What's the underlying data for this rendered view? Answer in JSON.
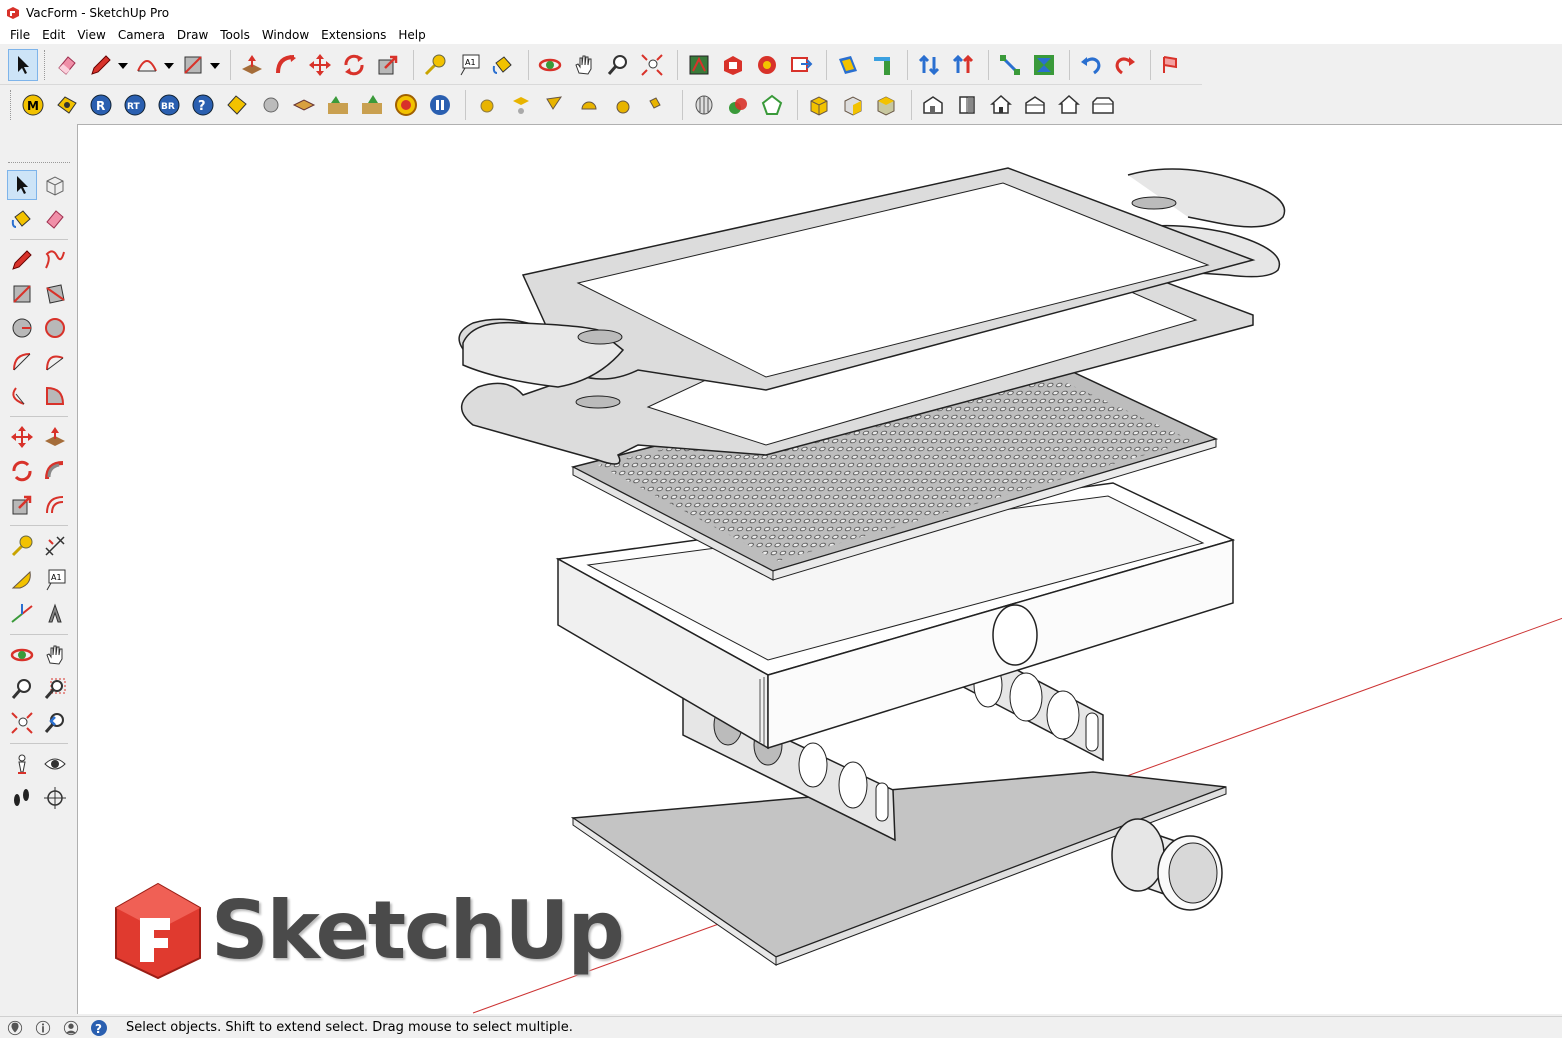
{
  "window": {
    "title": "VacForm - SketchUp Pro"
  },
  "menu": [
    "File",
    "Edit",
    "View",
    "Camera",
    "Draw",
    "Tools",
    "Window",
    "Extensions",
    "Help"
  ],
  "toolbar_row1": [
    "select",
    "eraser",
    "pencil",
    "dropdown",
    "arc",
    "dropdown",
    "rectangle",
    "dropdown",
    "push-pull",
    "follow-me",
    "move",
    "rotate",
    "scale",
    "tape-measure",
    "text",
    "paint-bucket",
    "orbit",
    "pan",
    "zoom",
    "zoom-extents",
    "warehouse",
    "extension-warehouse",
    "send-to-layout",
    "components",
    "section-plane",
    "display-section",
    "flip-axes",
    "reverse-faces",
    "intersect",
    "solid-tools",
    "undo",
    "redo",
    "sandbox"
  ],
  "toolbar_row2": [
    "M",
    "wheel",
    "R",
    "RT",
    "BR",
    "help",
    "tag",
    "sphere",
    "layer",
    "render1",
    "render2",
    "target",
    "pause",
    "yellow-sphere",
    "light",
    "flag",
    "dome",
    "half-sphere",
    "spot",
    "shell",
    "union",
    "subtract",
    "box-front",
    "box-iso",
    "box-top",
    "house1",
    "house2",
    "house3",
    "house4",
    "house5",
    "house6"
  ],
  "left_tools": [
    [
      "select",
      "component-make"
    ],
    [
      "paint",
      "eraser"
    ],
    [
      "line",
      "freehand"
    ],
    [
      "rectangle",
      "rotated-rectangle"
    ],
    [
      "circle",
      "polygon"
    ],
    [
      "arc",
      "2pt-arc"
    ],
    [
      "3pt-arc",
      "pie"
    ],
    [
      "move",
      "push-pull"
    ],
    [
      "rotate",
      "follow-me"
    ],
    [
      "scale",
      "offset"
    ],
    [
      "tape",
      "dimension"
    ],
    [
      "protractor",
      "text"
    ],
    [
      "axes",
      "3d-text"
    ],
    [
      "orbit",
      "pan"
    ],
    [
      "zoom",
      "zoom-window"
    ],
    [
      "zoom-extents",
      "previous"
    ],
    [
      "position-camera",
      "look-around"
    ],
    [
      "walk",
      "section"
    ]
  ],
  "logo": {
    "wordmark": "SketchUp"
  },
  "status": {
    "message": "Select objects. Shift to extend select. Drag mouse to select multiple."
  },
  "colors": {
    "logo_red": "#e03a2f",
    "axis_red": "#cc3333",
    "face_gray": "#c8c8c8"
  }
}
